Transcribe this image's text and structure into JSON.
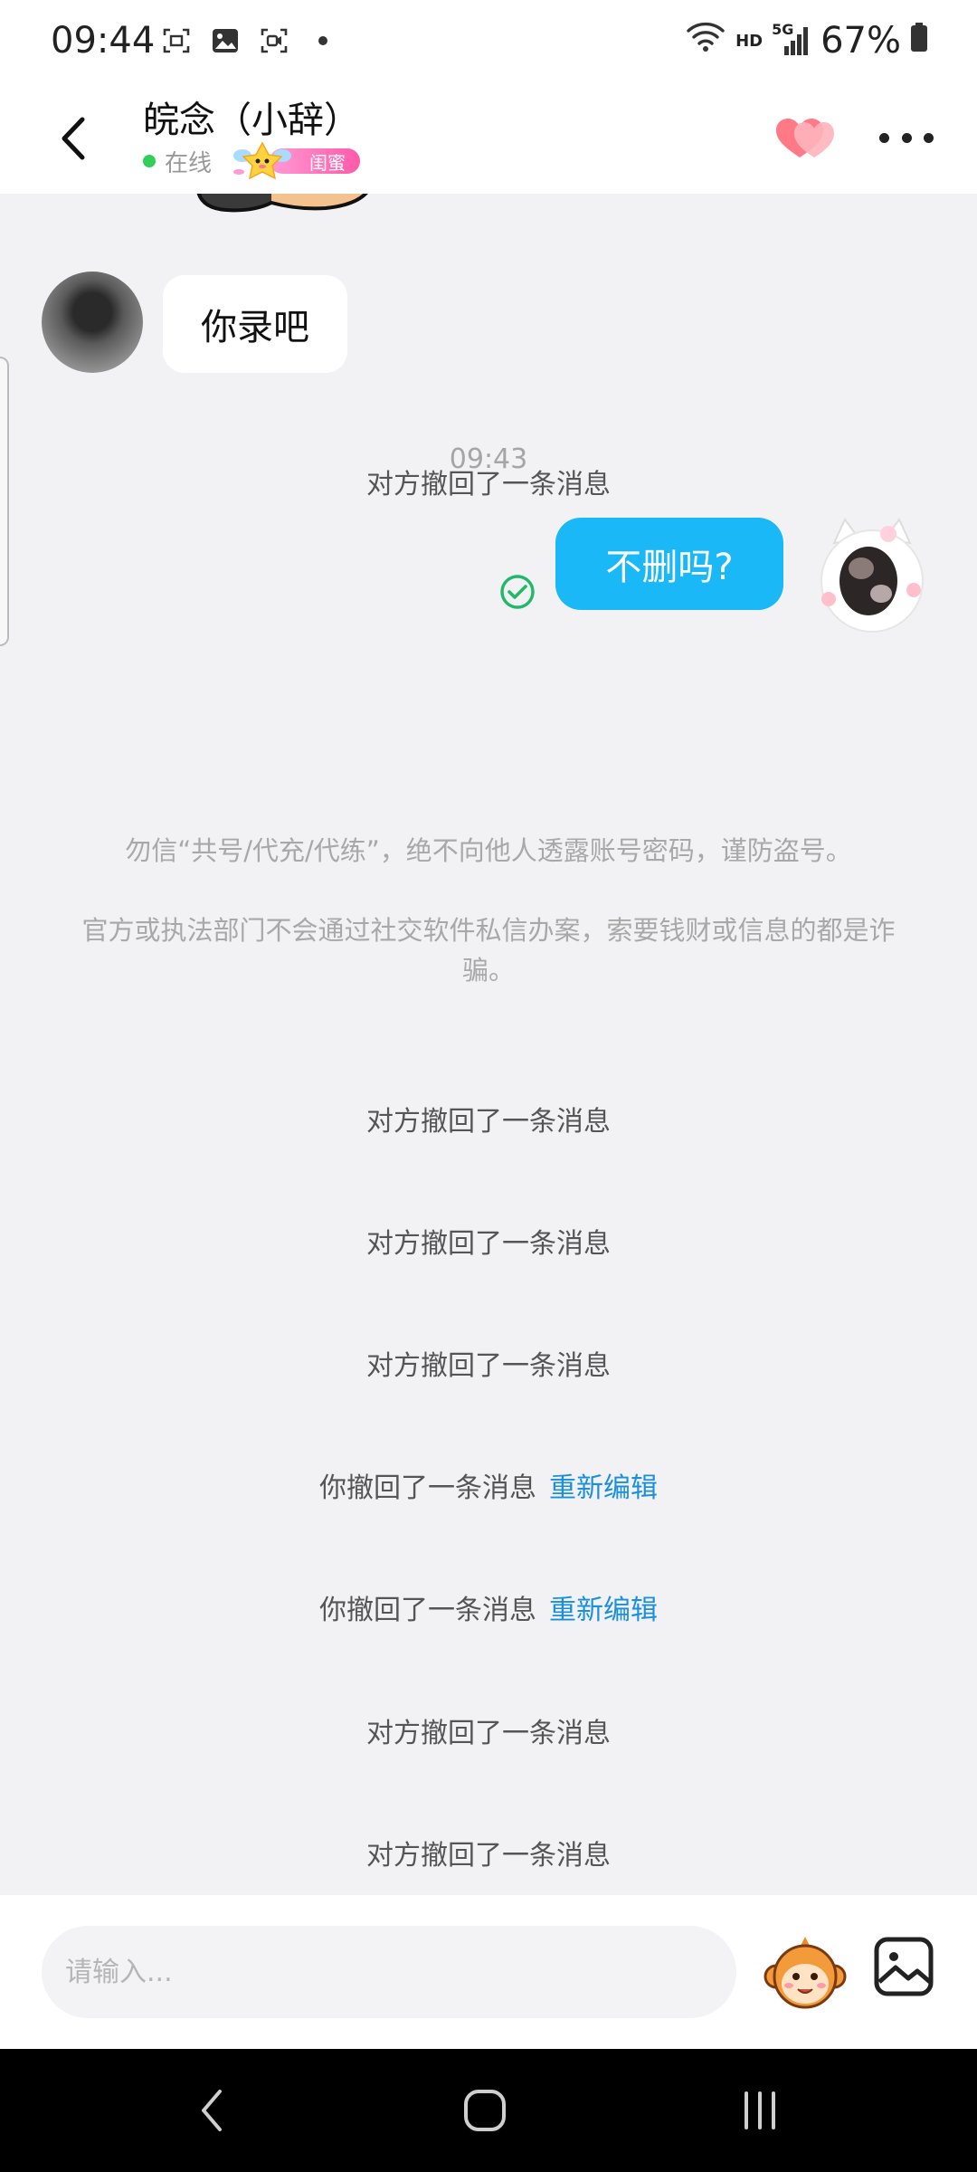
{
  "status_bar": {
    "time": "09:44",
    "network": "HD",
    "network_gen": "5G",
    "battery": "67%"
  },
  "header": {
    "contact_name": "皖念（小辞）",
    "status": "在线",
    "badge": "闺蜜",
    "online_color": "#2fcf5a"
  },
  "chat": {
    "received_message": "你录吧",
    "timestamp": "09:43",
    "sent_message": "不删吗?",
    "sent_bubble_color": "#1ab8f6",
    "system_lines": [
      "对方撤回了一条消息",
      "对方撤回了一条消息",
      "对方撤回了一条消息",
      "对方撤回了一条消息",
      "你撤回了一条消息",
      "你撤回了一条消息",
      "对方撤回了一条消息",
      "对方撤回了一条消息"
    ],
    "reedit_label": "重新编辑",
    "warning_1": "勿信“共号/代充/代练”，绝不向他人透露账号密码，谨防盗号。",
    "warning_2": "官方或执法部门不会通过社交软件私信办案，索要钱财或信息的都是诈骗。"
  },
  "input": {
    "placeholder": "请输入..."
  },
  "icons": {
    "back": "chevron-left-icon",
    "hearts": "hearts-icon",
    "more": "more-dots-icon",
    "read": "check-circle-icon",
    "emoji": "monkey-face-icon",
    "image": "image-icon"
  }
}
